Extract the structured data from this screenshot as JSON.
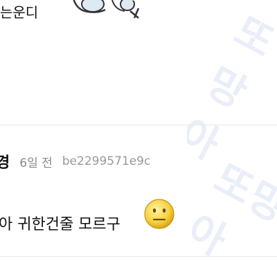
{
  "previous_comment": {
    "text_fragment": "는운디"
  },
  "comment": {
    "author_fragment": "경",
    "time": "6일 전",
    "user_id": "be2299571e9c",
    "text_fragment": "아 귀한건줄 모르구"
  },
  "watermark": {
    "text": "또망아",
    "color": "#e9eef8"
  },
  "icons": {
    "sticker": "dancing-character-sticker-icon",
    "emoji": "neutral-face-emoji-icon"
  }
}
